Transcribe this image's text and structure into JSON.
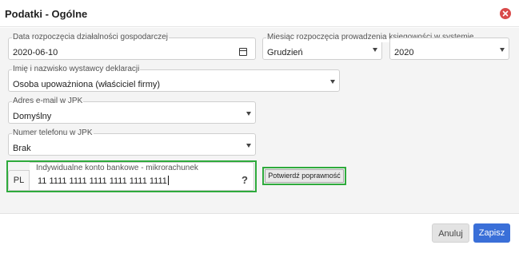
{
  "dialog": {
    "title": "Podatki - Ogólne",
    "close_icon": "close-circle-icon",
    "close_color": "#d94a4a"
  },
  "fields": {
    "start_date": {
      "label": "Data rozpoczęcia działalności gospodarczej",
      "value": "2020-06-10",
      "icon": "calendar-icon"
    },
    "accounting_month": {
      "label": "Miesiąc rozpoczęcia prowadzenia księgowości w systemie",
      "value": "Grudzień"
    },
    "accounting_year": {
      "value": "2020"
    },
    "issuer_name": {
      "label": "Imię i nazwisko wystawcy deklaracji",
      "value": "Osoba upoważniona (właściciel firmy)"
    },
    "jpk_email": {
      "label": "Adres e-mail w JPK",
      "value": "Domyślny"
    },
    "jpk_phone": {
      "label": "Numer telefonu w JPK",
      "value": "Brak"
    },
    "bank_account": {
      "prefix": "PL",
      "label": "Indywidualne konto bankowe - mikrorachunek",
      "value": "11 1111 1111 1111 1111 1111 1111",
      "help": "?"
    }
  },
  "buttons": {
    "verify": "Potwierdź poprawność",
    "cancel": "Anuluj",
    "save": "Zapisz"
  },
  "colors": {
    "highlight": "#2eaa3c",
    "primary": "#3a6fd8"
  }
}
